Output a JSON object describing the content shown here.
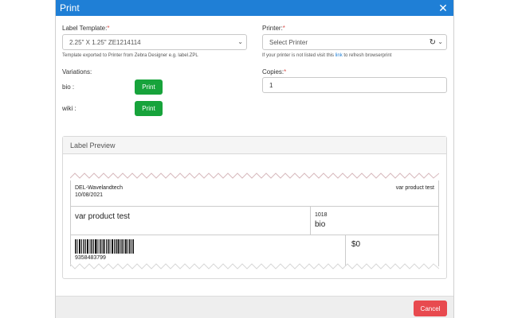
{
  "dialog": {
    "title": "Print",
    "close_glyph": "✕"
  },
  "template": {
    "label": "Label Template:",
    "required": "*",
    "selected": "2.25\" X 1.25\" ZE1214114",
    "help": "Template exported to Printer from Zebra Designer e.g. label.ZPL"
  },
  "printer": {
    "label": "Printer:",
    "required": "*",
    "selected": "Select Printer",
    "help_prefix": "If your printer is not listed visit this ",
    "help_link": "link",
    "help_suffix": " to refresh browserprint",
    "refresh_icon": "refresh-icon"
  },
  "variations": {
    "label": "Variations:",
    "items": [
      {
        "name": "bio :",
        "button": "Print"
      },
      {
        "name": "wiki :",
        "button": "Print"
      }
    ]
  },
  "copies": {
    "label": "Copies:",
    "required": "*",
    "value": "1"
  },
  "preview": {
    "heading": "Label Preview",
    "store": "DEL-Wavelandtech",
    "date": "10/08/2021",
    "product_top_right": "var product test",
    "product_name": "var product test",
    "variation_code": "1018",
    "variation_name": "bio",
    "barcode_number": "9358483799",
    "price": "$0"
  },
  "footer": {
    "cancel": "Cancel"
  },
  "colors": {
    "header": "#1f7fd6",
    "print_button": "#17a33b",
    "cancel_button": "#e84a4f"
  }
}
